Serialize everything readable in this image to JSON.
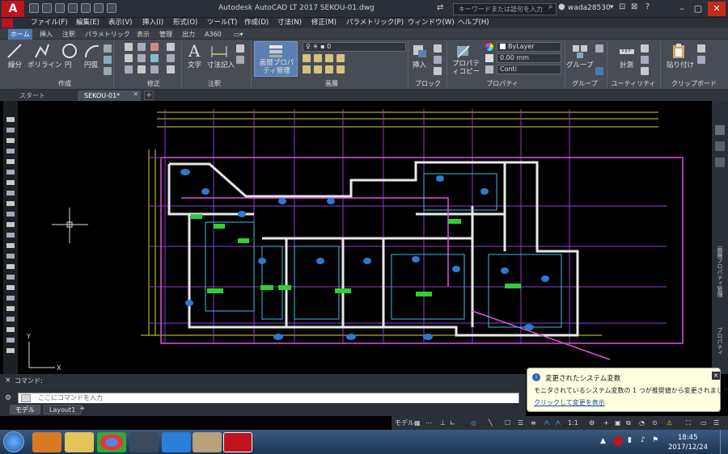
{
  "titlebar": {
    "app_logo": "A",
    "title": "Autodesk AutoCAD LT 2017     SEKOU-01.dwg",
    "search_placeholder": "キーワードまたは語句を入力",
    "user_name": "wada28530"
  },
  "menubar": {
    "items": [
      "ファイル(F)",
      "編集(E)",
      "表示(V)",
      "挿入(I)",
      "形式(O)",
      "ツール(T)",
      "作成(D)",
      "寸法(N)",
      "修正(M)",
      "パラメトリック(P)",
      "ウィンドウ(W)",
      "ヘルプ(H)"
    ]
  },
  "ribbon_tabs": [
    "ホーム",
    "挿入",
    "注釈",
    "パラメトリック",
    "表示",
    "管理",
    "出力",
    "A360"
  ],
  "ribbon": {
    "draw": {
      "title": "作成",
      "line": "線分",
      "polyline": "ポリライン",
      "circle": "円",
      "arc": "円弧"
    },
    "modify": {
      "title": "修正"
    },
    "annotation": {
      "title": "注釈",
      "text": "文字",
      "dimension": "寸法記入"
    },
    "layers": {
      "title": "画層",
      "layer_properties": "画層プロパティ管理",
      "current_layer": "0"
    },
    "block": {
      "title": "ブロック",
      "insert": "挿入"
    },
    "properties": {
      "title": "プロパティ",
      "match": "プロパティコピー",
      "color": "ByLayer",
      "lineweight": "0.00 mm",
      "linetype": "Conti"
    },
    "groups": {
      "title": "グループ",
      "group": "グループ"
    },
    "utilities": {
      "title": "ユーティリティ",
      "measure": "計測"
    },
    "clipboard": {
      "title": "クリップボード",
      "paste": "貼り付け"
    }
  },
  "doc_tabs": [
    "スタート",
    "SEKOU-01*"
  ],
  "side_palette": {
    "layer_props": "画層プロパティ管理",
    "properties": "プロパティ"
  },
  "command": {
    "history": "コマンド:",
    "placeholder": "ここにコマンドを入力"
  },
  "layout_tabs": [
    "モデル",
    "Layout1"
  ],
  "status": {
    "model": "モデル",
    "scale": "1:1"
  },
  "balloon": {
    "title": "変更されたシステム変数",
    "body": "モニタされているシステム変数の 1 つが推奨値から変更されました",
    "link": "クリックして変更を表示"
  },
  "taskbar": {
    "time": "18:45",
    "date": "2017/12/24"
  },
  "colors": {
    "accent": "#4d78b5",
    "brand": "#c1121f"
  }
}
